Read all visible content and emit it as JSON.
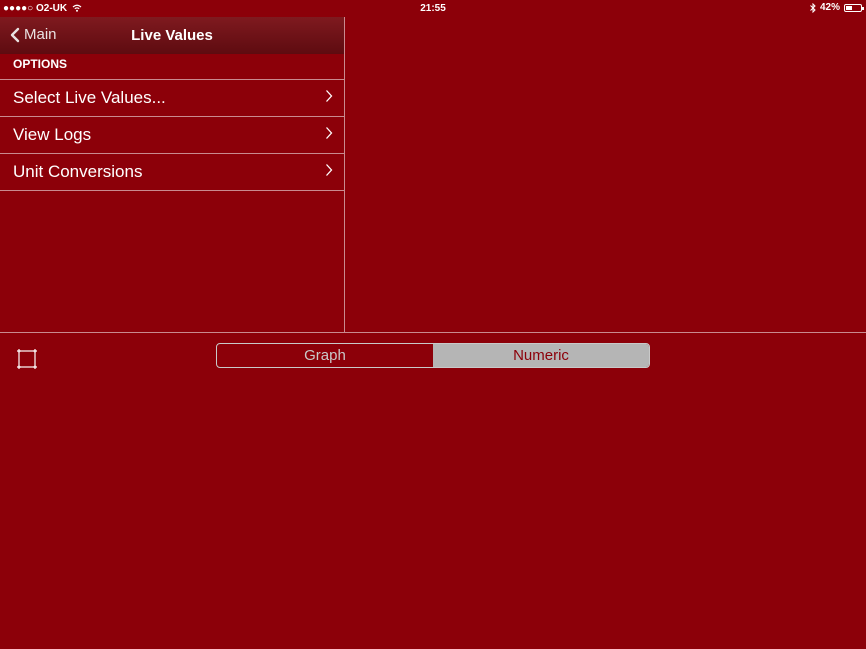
{
  "status_bar": {
    "carrier": "●●●●○ O2-UK",
    "time": "21:55",
    "battery_text": "42%",
    "battery_level": 0.42,
    "wifi_icon": "wifi-icon",
    "bluetooth_icon": "bluetooth-icon"
  },
  "nav": {
    "back_label": "Main",
    "title": "Live Values"
  },
  "section_header": "OPTIONS",
  "options": [
    {
      "label": "Select Live Values..."
    },
    {
      "label": "View Logs"
    },
    {
      "label": "Unit Conversions"
    }
  ],
  "segmented": {
    "graph_label": "Graph",
    "numeric_label": "Numeric",
    "selected": "Numeric"
  },
  "colors": {
    "background": "#8c0009",
    "selected_segment": "#b5b5b5"
  }
}
